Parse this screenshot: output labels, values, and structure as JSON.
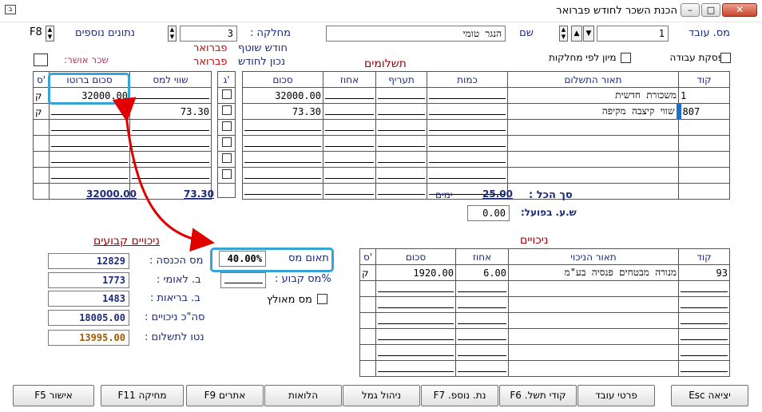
{
  "window": {
    "title": "הכנת השכר לחודש פברואר"
  },
  "header": {
    "employee_label": "מס. עובד",
    "employee_no": "1",
    "name_label": "שם",
    "name_value": "הנגר טומי",
    "dept_label": "מחלקה :",
    "dept_value": "3",
    "extra_label": "נתונים נוספים",
    "extra_key": "F8",
    "partner_month_label": "חודש שוטף",
    "partner_month_value": "פברואר",
    "correct_label": "נכון לחודש",
    "correct_value": "פברואר",
    "approval_label": "שכר אושר:",
    "stop_work_label": "הפסקת עבודה",
    "sort_label": "מיון לפי מחלקות",
    "pay_title": "תשלומים"
  },
  "payments": {
    "headers": [
      "קוד",
      "תאור התשלום",
      "כמות",
      "תעריף",
      "אחוז",
      "סכום"
    ],
    "rows": [
      {
        "code": "1",
        "desc": "משכורת חדשית",
        "amount": "32000.00"
      },
      {
        "code": "807",
        "desc": "שווי קיצבה מקיפה",
        "amount": "73.30"
      }
    ],
    "g_header": "ג'",
    "left_headers": [
      "שווי למס",
      "סכום ברוטו",
      "ס'"
    ],
    "left_rows": [
      {
        "tax": "",
        "gross": "32000.00",
        "s": "ק"
      },
      {
        "tax": "73.30",
        "gross": "",
        "s": "ק"
      }
    ],
    "gross_total": "32000.00",
    "tax_total": "73.30"
  },
  "summary": {
    "total_label": "סך הכל :",
    "total_value": "25.00",
    "days_label": "ימים",
    "hours_label": "ש.ע. בפועל:",
    "hours_value": "0.00"
  },
  "deductions": {
    "title": "ניכויים",
    "headers": [
      "קוד",
      "תאור הניכוי",
      "אחוז",
      "סכום",
      "ס'"
    ],
    "rows": [
      {
        "code": "93",
        "desc": "מנורה מבטחים פנסיה בע\"מ",
        "pct": "6.00",
        "amount": "1920.00",
        "s": "ק"
      }
    ]
  },
  "fixed": {
    "title": "ניכויים קבועים",
    "income_tax_label": "מס הכנסה :",
    "income_tax": "12829",
    "national_label": "ב. לאומי :",
    "national": "1773",
    "health_label": "ב. בריאות :",
    "health": "1483",
    "total_label": "סה\"כ ניכויים :",
    "total": "18005.00",
    "net_label": "נטו לתשלום :",
    "net": "13995.00"
  },
  "tax": {
    "adjust_label": "תאום מס",
    "adjust_value": "40.00%",
    "fixed_label": "%מס קבוע :",
    "imposed_label": "מס מאולץ"
  },
  "buttons": [
    "יציאה Esc",
    "פרטי עובד",
    "קודי תשל. F6",
    "נת. נוספ. F7",
    "ניהול גמל",
    "הלואות",
    "אתרים F9",
    "מחיקה F11",
    "אישור F5"
  ],
  "colors": {
    "highlight": "#36a3d9",
    "arrow": "#e00000",
    "label": "#1c2a7c",
    "red": "#cc0000"
  }
}
